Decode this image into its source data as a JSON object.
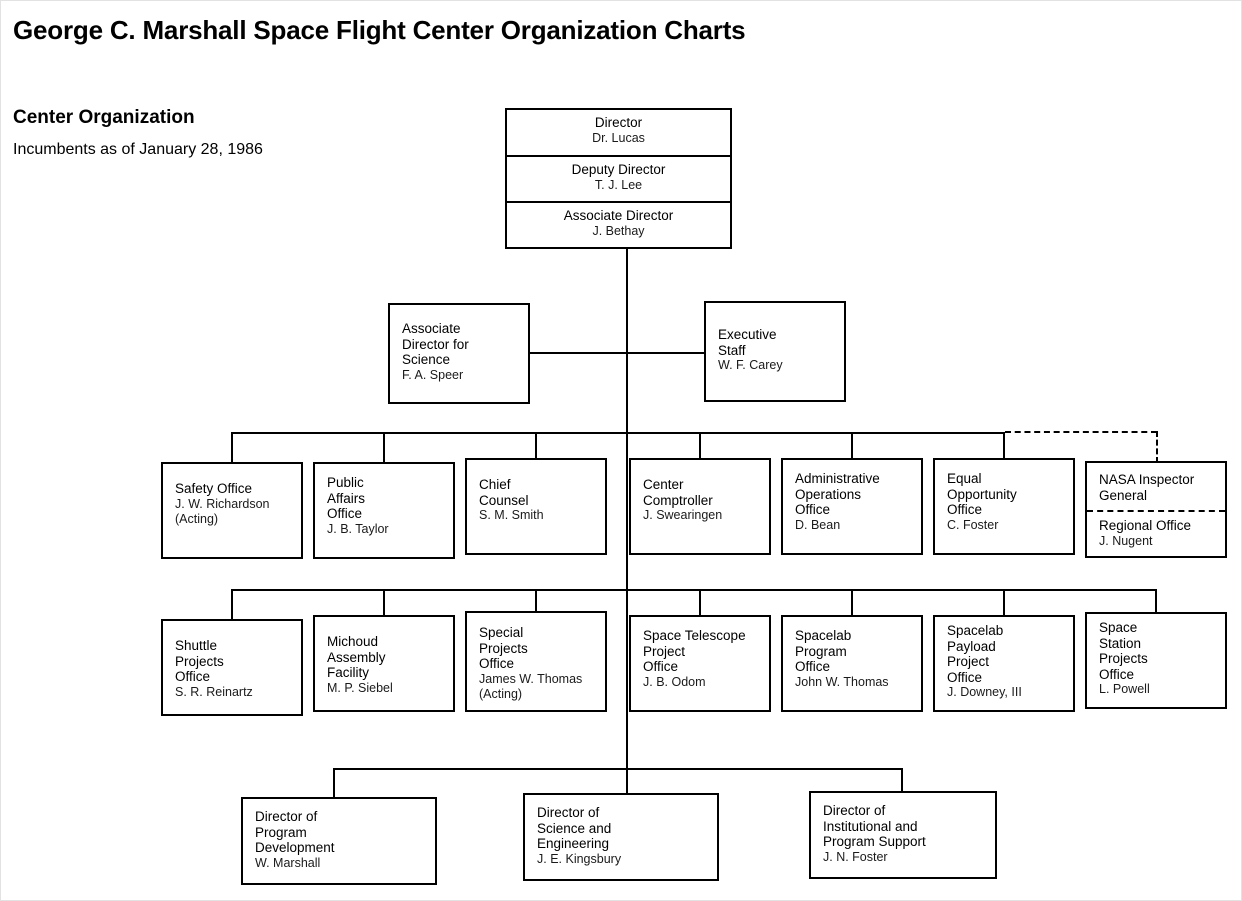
{
  "document": {
    "title": "George C. Marshall Space Flight Center Organization Charts",
    "section_title": "Center Organization",
    "section_subtitle": "Incumbents as of January 28, 1986"
  },
  "chart_data": {
    "type": "diagram",
    "diagram_kind": "organization-chart",
    "title": "Center Organization",
    "subtitle": "Incumbents as of January 28, 1986",
    "nodes": [
      {
        "id": "director",
        "level": 0,
        "align": "center",
        "segments": [
          {
            "title": "Director",
            "name": "Dr. Lucas"
          },
          {
            "title": "Deputy Director",
            "name": "T. J. Lee"
          },
          {
            "title": "Associate Director",
            "name": "J. Bethay"
          }
        ]
      },
      {
        "id": "assoc-dir-science",
        "level": 1,
        "align": "left",
        "title_lines": [
          "Associate",
          "Director for",
          "Science"
        ],
        "name": "F. A. Speer"
      },
      {
        "id": "executive-staff",
        "level": 1,
        "align": "left",
        "title_lines": [
          "Executive",
          "Staff"
        ],
        "name": "W. F. Carey"
      },
      {
        "id": "safety-office",
        "level": 2,
        "align": "left",
        "title_lines": [
          "Safety Office"
        ],
        "name": "J. W. Richardson",
        "note": "(Acting)"
      },
      {
        "id": "public-affairs-office",
        "level": 2,
        "align": "left",
        "title_lines": [
          "Public",
          "Affairs",
          "Office"
        ],
        "name": "J. B. Taylor"
      },
      {
        "id": "chief-counsel",
        "level": 2,
        "align": "left",
        "title_lines": [
          "Chief",
          "Counsel"
        ],
        "name": "S. M. Smith"
      },
      {
        "id": "center-comptroller",
        "level": 2,
        "align": "left",
        "title_lines": [
          "Center",
          "Comptroller"
        ],
        "name": "J. Swearingen"
      },
      {
        "id": "administrative-operations-office",
        "level": 2,
        "align": "left",
        "title_lines": [
          "Administrative",
          "Operations",
          "Office"
        ],
        "name": "D. Bean"
      },
      {
        "id": "equal-opportunity-office",
        "level": 2,
        "align": "left",
        "title_lines": [
          "Equal",
          "Opportunity",
          "Office"
        ],
        "name": "C. Foster"
      },
      {
        "id": "nasa-inspector-general",
        "level": 2,
        "align": "left",
        "connector": "dashed",
        "segments": [
          {
            "title_lines": [
              "NASA Inspector",
              "General"
            ]
          },
          {
            "title_lines": [
              "Regional Office"
            ],
            "name": "J. Nugent"
          }
        ]
      },
      {
        "id": "shuttle-projects-office",
        "level": 3,
        "align": "left",
        "title_lines": [
          "Shuttle",
          "Projects",
          "Office"
        ],
        "name": "S. R. Reinartz"
      },
      {
        "id": "michoud-assembly-facility",
        "level": 3,
        "align": "left",
        "title_lines": [
          "Michoud",
          "Assembly",
          "Facility"
        ],
        "name": "M. P. Siebel"
      },
      {
        "id": "special-projects-office",
        "level": 3,
        "align": "left",
        "title_lines": [
          "Special",
          "Projects",
          "Office"
        ],
        "name": "James W. Thomas",
        "note": "(Acting)"
      },
      {
        "id": "space-telescope-project-office",
        "level": 3,
        "align": "left",
        "title_lines": [
          "Space Telescope",
          "Project",
          "Office"
        ],
        "name": "J. B. Odom"
      },
      {
        "id": "spacelab-program-office",
        "level": 3,
        "align": "left",
        "title_lines": [
          "Spacelab",
          "Program",
          "Office"
        ],
        "name": "John W. Thomas"
      },
      {
        "id": "spacelab-payload-project-office",
        "level": 3,
        "align": "left",
        "title_lines": [
          "Spacelab",
          "Payload",
          "Project",
          "Office"
        ],
        "name": "J. Downey, III"
      },
      {
        "id": "space-station-projects-office",
        "level": 3,
        "align": "left",
        "title_lines": [
          "Space",
          "Station",
          "Projects",
          "Office"
        ],
        "name": "L. Powell"
      },
      {
        "id": "director-program-development",
        "level": 4,
        "align": "left",
        "title_lines": [
          "Director of",
          "Program",
          "Development"
        ],
        "name": "W. Marshall"
      },
      {
        "id": "director-science-engineering",
        "level": 4,
        "align": "left",
        "title_lines": [
          "Director of",
          "Science and",
          "Engineering"
        ],
        "name": "J. E. Kingsbury"
      },
      {
        "id": "director-institutional-program-support",
        "level": 4,
        "align": "left",
        "title_lines": [
          "Director of",
          "Institutional and",
          "Program Support"
        ],
        "name": "J. N. Foster"
      }
    ]
  },
  "boxes": {
    "director": {
      "s1_title": "Director",
      "s1_name": "Dr. Lucas",
      "s2_title": "Deputy Director",
      "s2_name": "T. J. Lee",
      "s3_title": "Associate Director",
      "s3_name": "J. Bethay"
    },
    "assoc_science": {
      "l1": "Associate",
      "l2": "Director for",
      "l3": "Science",
      "name": "F. A. Speer"
    },
    "exec_staff": {
      "l1": "Executive",
      "l2": "Staff",
      "name": "W. F. Carey"
    },
    "safety": {
      "l1": "Safety Office",
      "name": "J. W. Richardson",
      "note": "(Acting)"
    },
    "public_affairs": {
      "l1": "Public",
      "l2": "Affairs",
      "l3": "Office",
      "name": "J. B. Taylor"
    },
    "chief_counsel": {
      "l1": "Chief",
      "l2": "Counsel",
      "name": "S. M. Smith"
    },
    "comptroller": {
      "l1": "Center",
      "l2": "Comptroller",
      "name": "J. Swearingen"
    },
    "admin_ops": {
      "l1": "Administrative",
      "l2": "Operations",
      "l3": "Office",
      "name": "D. Bean"
    },
    "equal_opp": {
      "l1": "Equal",
      "l2": "Opportunity",
      "l3": "Office",
      "name": "C. Foster"
    },
    "inspector_general": {
      "l1": "NASA Inspector",
      "l2": "General",
      "r1": "Regional Office",
      "r_name": "J. Nugent"
    },
    "shuttle": {
      "l1": "Shuttle",
      "l2": "Projects",
      "l3": "Office",
      "name": "S. R. Reinartz"
    },
    "michoud": {
      "l1": "Michoud",
      "l2": "Assembly",
      "l3": "Facility",
      "name": "M. P. Siebel"
    },
    "special_projects": {
      "l1": "Special",
      "l2": "Projects",
      "l3": "Office",
      "name": "James W. Thomas",
      "note": "(Acting)"
    },
    "space_telescope": {
      "l1": "Space Telescope",
      "l2": "Project",
      "l3": "Office",
      "name": "J. B. Odom"
    },
    "spacelab_program": {
      "l1": "Spacelab",
      "l2": "Program",
      "l3": "Office",
      "name": "John W. Thomas"
    },
    "spacelab_payload": {
      "l1": "Spacelab",
      "l2": "Payload",
      "l3": "Project",
      "l4": "Office",
      "name": "J. Downey, III"
    },
    "space_station": {
      "l1": "Space",
      "l2": "Station",
      "l3": "Projects",
      "l4": "Office",
      "name": "L. Powell"
    },
    "dir_program_dev": {
      "l1": "Director of",
      "l2": "Program",
      "l3": "Development",
      "name": "W. Marshall"
    },
    "dir_science_eng": {
      "l1": "Director of",
      "l2": "Science and",
      "l3": "Engineering",
      "name": "J. E. Kingsbury"
    },
    "dir_inst_support": {
      "l1": "Director of",
      "l2": "Institutional and",
      "l3": "Program Support",
      "name": "J. N. Foster"
    }
  }
}
